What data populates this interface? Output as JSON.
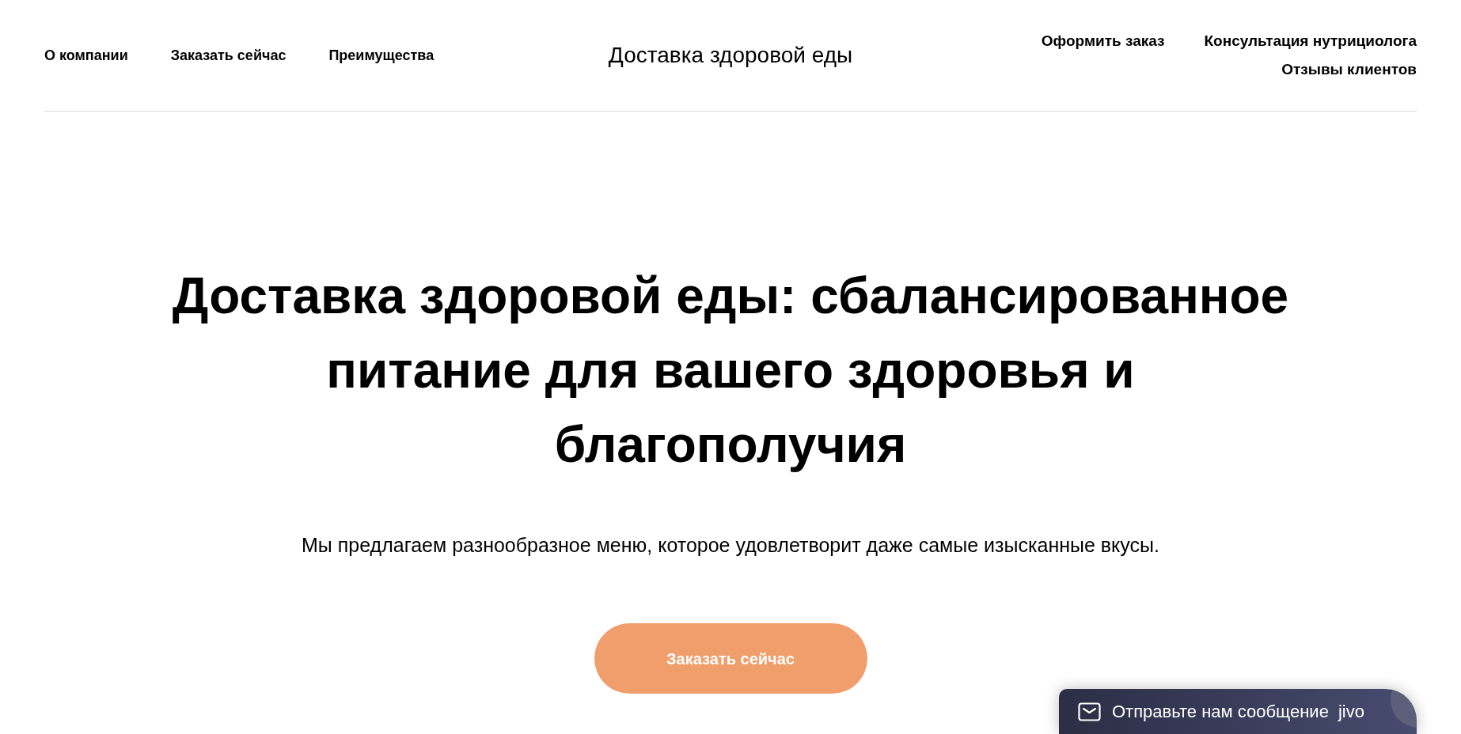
{
  "header": {
    "nav_left": [
      "О компании",
      "Заказать сейчас",
      "Преимущества"
    ],
    "site_title": "Доставка здоровой еды",
    "nav_right": [
      "Оформить заказ",
      "Консультация нутрициолога",
      "Отзывы клиентов"
    ]
  },
  "hero": {
    "headline": "Доставка здоровой еды: сбалансированное питание для вашего здоровья и благополучия",
    "subtitle": "Мы предлагаем разнообразное меню, которое удовлетворит даже самые изысканные вкусы.",
    "cta_button": "Заказать сейчас"
  },
  "chat_widget": {
    "label": "Отправьте нам сообщение",
    "logo": "jivo"
  }
}
